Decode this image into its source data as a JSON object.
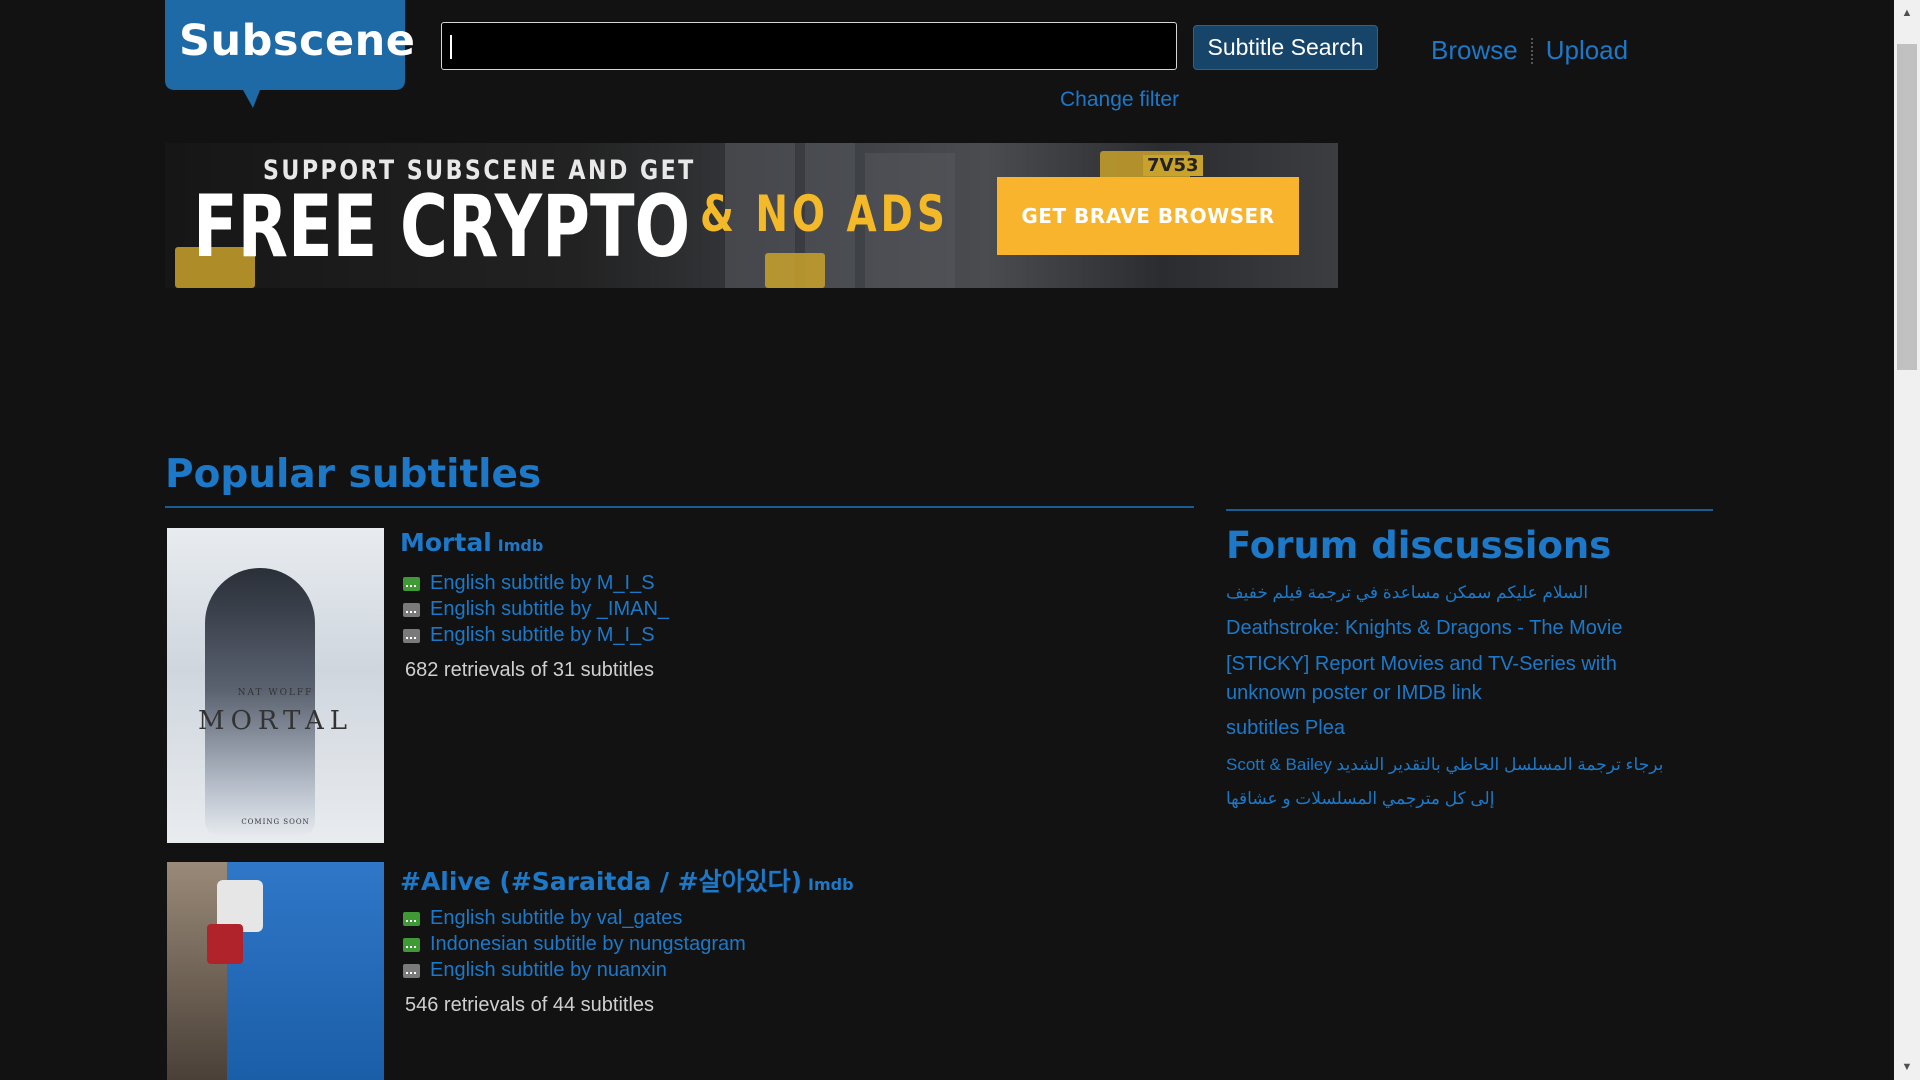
{
  "header": {
    "logo_text": "Subscene",
    "search_value": "",
    "search_button": "Subtitle Search",
    "change_filter": "Change filter",
    "nav": [
      "Browse",
      "Upload"
    ]
  },
  "banner": {
    "line1": "SUPPORT SUBSCENE AND GET",
    "line2": "FREE CRYPTO",
    "line3": "& NO ADS",
    "cta": "GET BRAVE BROWSER",
    "plate": "7V53"
  },
  "popular": {
    "title": "Popular subtitles",
    "items": [
      {
        "title": "Mortal",
        "imdb": "Imdb",
        "poster_text": {
          "credit": "NAT WOLFF",
          "name": "MORTAL",
          "soon": "COMING SOON"
        },
        "subs": [
          {
            "text": "English subtitle by M_I_S",
            "rated": "green"
          },
          {
            "text": "English subtitle by _IMAN_",
            "rated": "gray"
          },
          {
            "text": "English subtitle by M_I_S",
            "rated": "gray"
          }
        ],
        "stats": "682 retrievals of 31 subtitles"
      },
      {
        "title": "#Alive (#Saraitda / #살아있다)",
        "imdb": "Imdb",
        "subs": [
          {
            "text": "English subtitle by val_gates",
            "rated": "green"
          },
          {
            "text": "Indonesian subtitle by nungstagram",
            "rated": "green"
          },
          {
            "text": "English subtitle by nuanxin",
            "rated": "gray"
          }
        ],
        "stats": "546 retrievals of 44 subtitles"
      }
    ]
  },
  "forum": {
    "title": "Forum discussions",
    "links": [
      "السلام عليكم سمكن مساعدة في ترجمة فيلم خفيف",
      "Deathstroke: Knights & Dragons - The Movie",
      "[STICKY] Report Movies and TV-Series with unknown poster or IMDB link",
      "subtitles Plea",
      "برجاء ترجمة المسلسل الحاظي بالتقدير الشديد Scott & Bailey",
      "إلى كل مترجمي المسلسلات و عشاقها"
    ]
  },
  "colors": {
    "link": "#1e78c8",
    "background": "#121212",
    "button": "#17456a",
    "accent": "#f7b42c"
  }
}
